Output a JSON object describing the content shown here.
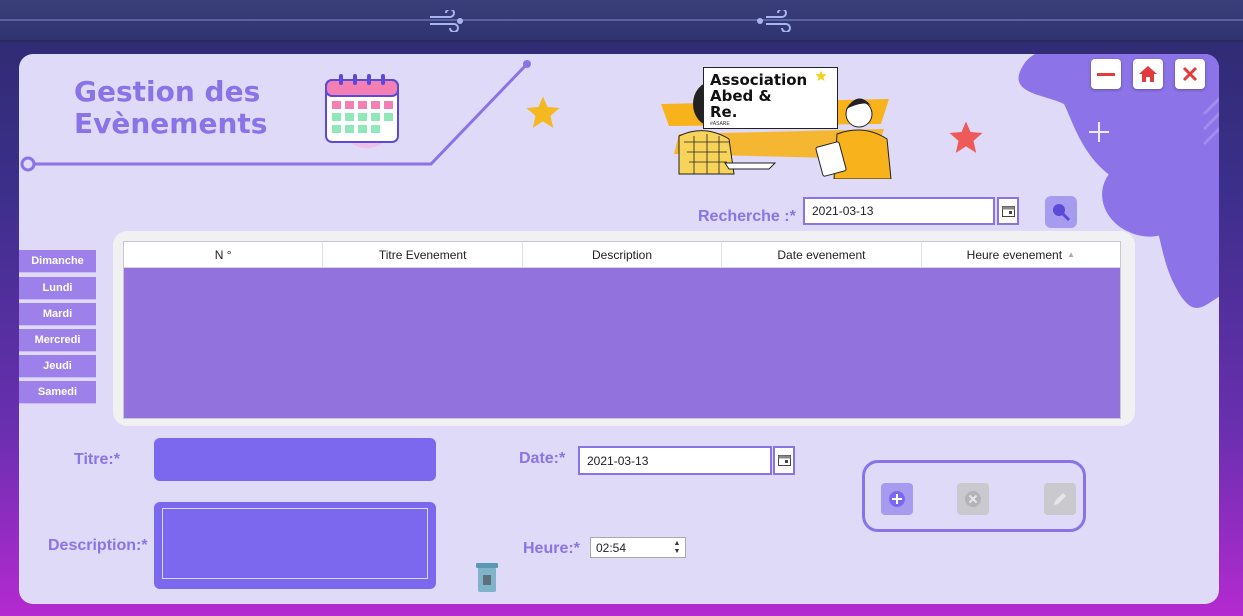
{
  "app": {
    "title": "Gestion des\nEvènements",
    "logo_text": "Association\nAbed &\nRe.",
    "logo_subtext": "#ASARE"
  },
  "window_controls": {
    "minimize_icon": "minimize-icon",
    "home_icon": "home-icon",
    "close_icon": "close-icon"
  },
  "search": {
    "label": "Recherche :*",
    "value": "2021-03-13"
  },
  "days": [
    "Dimanche",
    "Lundi",
    "Mardi",
    "Mercredi",
    "Jeudi",
    "Samedi"
  ],
  "table": {
    "columns": [
      "N °",
      "Titre Evenement",
      "Description",
      "Date evenement",
      "Heure evenement"
    ],
    "sorted_column": "Heure evenement",
    "rows": []
  },
  "form": {
    "titre_label": "Titre:*",
    "titre_value": "",
    "description_label": "Description:*",
    "description_value": "",
    "date_label": "Date:*",
    "date_value": "2021-03-13",
    "heure_label": "Heure:*",
    "heure_value": "02:54"
  },
  "colors": {
    "accent": "#8a73e6",
    "panel": "#dfdaf7",
    "table_body": "#9272dc",
    "input_fill": "#7b68ee",
    "close_red": "#e23b3b"
  }
}
